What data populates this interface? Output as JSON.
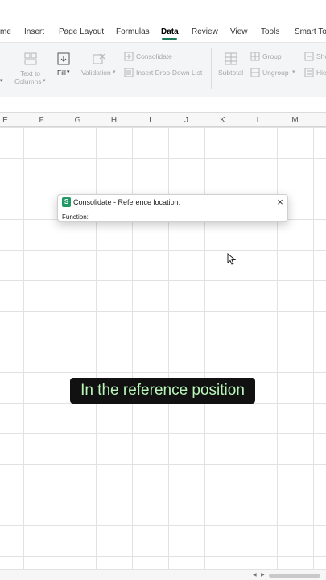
{
  "menu": {
    "tabs": [
      {
        "label": "me"
      },
      {
        "label": "Insert"
      },
      {
        "label": "Page Layout"
      },
      {
        "label": "Formulas"
      },
      {
        "label": "Data"
      },
      {
        "label": "Review"
      },
      {
        "label": "View"
      },
      {
        "label": "Tools"
      },
      {
        "label": "Smart To"
      }
    ],
    "active_tab": "Data"
  },
  "ribbon": {
    "text_to_columns_line1": "Text to",
    "text_to_columns_line2": "Columns",
    "fill": "Fill",
    "validation": "Validation",
    "consolidate": "Consolidate",
    "insert_dropdown_list": "Insert Drop-Down List",
    "subtotal": "Subtotal",
    "group": "Group",
    "ungroup": "Ungroup",
    "show_partial": "Sho",
    "hide_partial": "Hic",
    "accent_color": "#1f7a5a"
  },
  "columns": [
    "E",
    "F",
    "G",
    "H",
    "I",
    "J",
    "K",
    "L",
    "M"
  ],
  "dialog": {
    "logo": "S",
    "title": "Consolidate - Reference location:",
    "function_label": "Function:",
    "close_icon": "×"
  },
  "caption": {
    "text": "In the reference position"
  }
}
